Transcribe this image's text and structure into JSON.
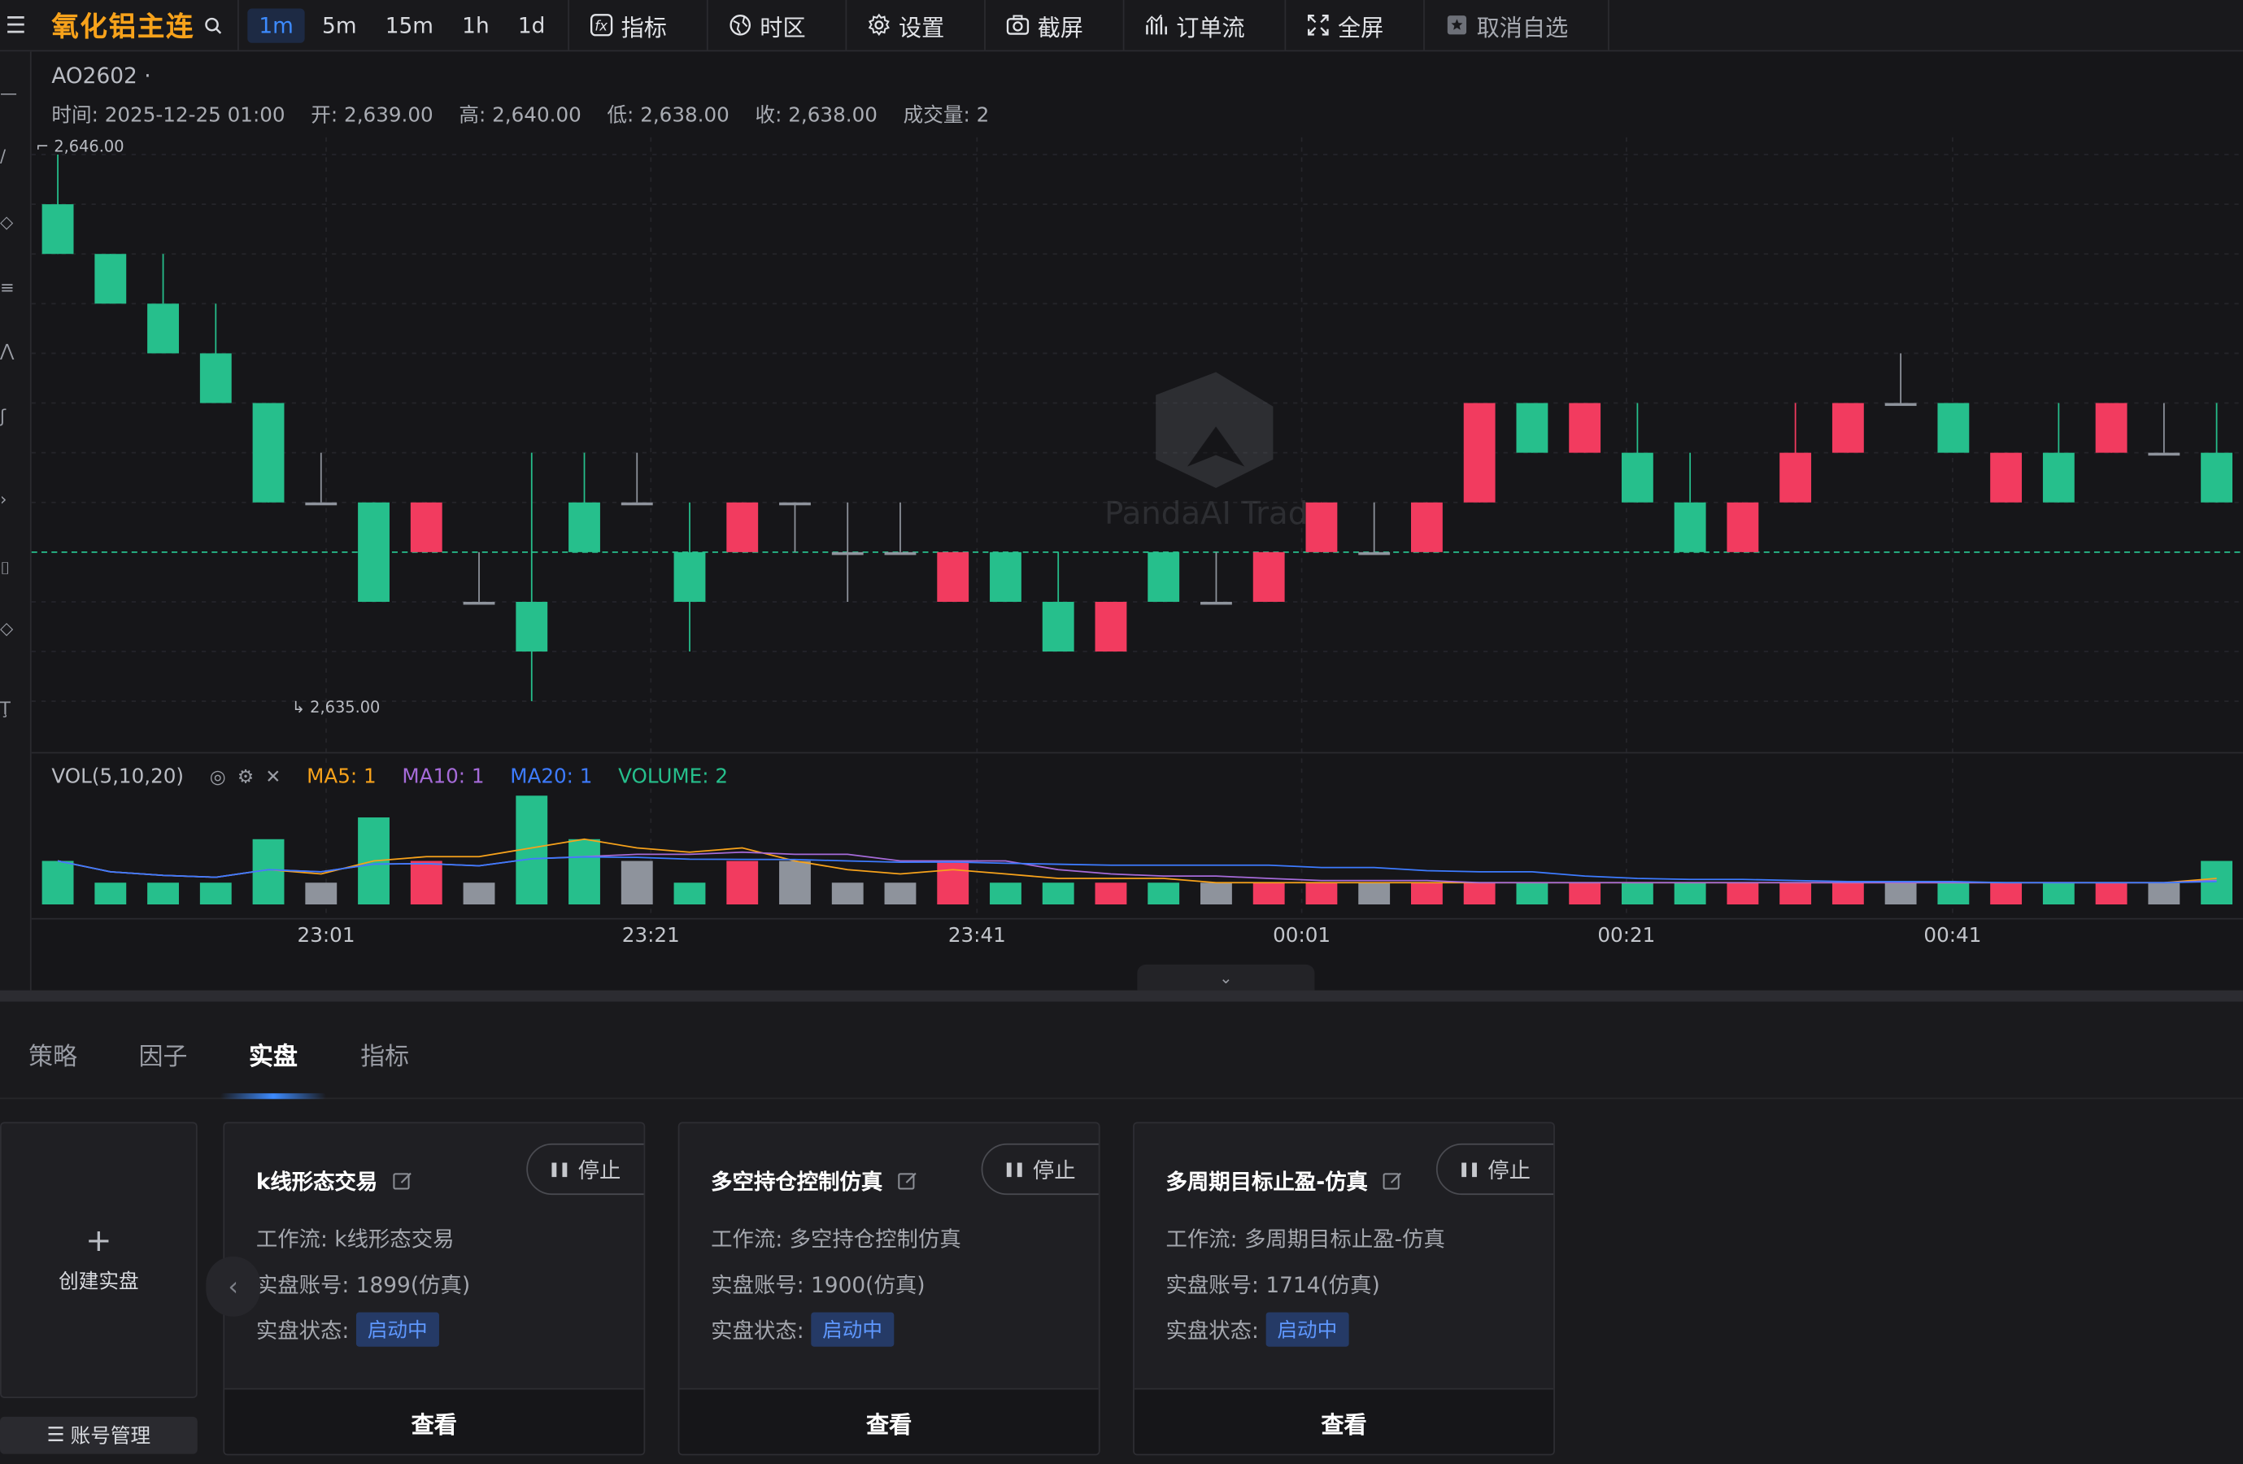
{
  "toolbar": {
    "symbol": "氧化铝主连",
    "periods": [
      "1m",
      "5m",
      "15m",
      "1h",
      "1d"
    ],
    "active_period": "1m",
    "indicators": "指标",
    "timezone": "时区",
    "settings": "设置",
    "screenshot": "截屏",
    "orderflow": "订单流",
    "fullscreen": "全屏",
    "unfavorite": "取消自选"
  },
  "chart": {
    "contract": "AO2602 ·",
    "ohlc": {
      "time_label": "时间:",
      "time": "2025-12-25 01:00",
      "open_label": "开:",
      "open": "2,639.00",
      "high_label": "高:",
      "high": "2,640.00",
      "low_label": "低:",
      "low": "2,638.00",
      "close_label": "收:",
      "close": "2,638.00",
      "volume_label": "成交量:",
      "volume": "2"
    },
    "max_label": "2,646.00",
    "min_label": "2,635.00",
    "watermark": "PandaAI Trade",
    "volume_panel": {
      "title": "VOL(5,10,20)",
      "ma5": "MA5: 1",
      "ma10": "MA10: 1",
      "ma20": "MA20: 1",
      "volume": "VOLUME: 2"
    },
    "time_ticks": [
      "23:01",
      "23:21",
      "23:41",
      "00:01",
      "00:21",
      "00:41"
    ],
    "colors": {
      "up": "#f23b5f",
      "down": "#26bf8c",
      "flat": "#8e939c",
      "ma5": "#f7a21b",
      "ma10": "#a66bd9",
      "ma20": "#3d7bff",
      "volume": "#26bf8c",
      "accent": "#3d8bff"
    }
  },
  "chart_data": {
    "type": "candlestick",
    "y_range": [
      2635,
      2646
    ],
    "reference_price": 2638,
    "candles": [
      [
        2645,
        2646,
        2644,
        2644
      ],
      [
        2644,
        2644,
        2643,
        2643
      ],
      [
        2643,
        2644,
        2643,
        2642
      ],
      [
        2642,
        2643,
        2641,
        2641
      ],
      [
        2641,
        2641,
        2639,
        2639
      ],
      [
        2639,
        2640,
        2639,
        2639
      ],
      [
        2639,
        2639,
        2637,
        2637
      ],
      [
        2638,
        2639,
        2638,
        2639
      ],
      [
        2637,
        2638,
        2637,
        2637
      ],
      [
        2637,
        2640,
        2635,
        2636
      ],
      [
        2639,
        2640,
        2638,
        2638
      ],
      [
        2639,
        2640,
        2639,
        2639
      ],
      [
        2638,
        2639,
        2636,
        2637
      ],
      [
        2638,
        2639,
        2638,
        2639
      ],
      [
        2639,
        2639,
        2638,
        2639
      ],
      [
        2638,
        2639,
        2637,
        2638
      ],
      [
        2638,
        2639,
        2638,
        2638
      ],
      [
        2637,
        2638,
        2637,
        2638
      ],
      [
        2638,
        2638,
        2637,
        2637
      ],
      [
        2637,
        2638,
        2636,
        2636
      ],
      [
        2636,
        2637,
        2636,
        2637
      ],
      [
        2638,
        2638,
        2637,
        2637
      ],
      [
        2637,
        2638,
        2637,
        2637
      ],
      [
        2637,
        2638,
        2637,
        2638
      ],
      [
        2638,
        2639,
        2638,
        2639
      ],
      [
        2638,
        2639,
        2638,
        2638
      ],
      [
        2638,
        2639,
        2638,
        2639
      ],
      [
        2639,
        2641,
        2639,
        2641
      ],
      [
        2641,
        2641,
        2640,
        2640
      ],
      [
        2640,
        2641,
        2640,
        2641
      ],
      [
        2640,
        2641,
        2639,
        2639
      ],
      [
        2639,
        2640,
        2639,
        2638
      ],
      [
        2638,
        2639,
        2638,
        2639
      ],
      [
        2639,
        2641,
        2639,
        2640
      ],
      [
        2640,
        2641,
        2640,
        2641
      ],
      [
        2641,
        2642,
        2641,
        2641
      ],
      [
        2641,
        2641,
        2640,
        2640
      ],
      [
        2639,
        2640,
        2639,
        2640
      ],
      [
        2640,
        2641,
        2639,
        2639
      ],
      [
        2640,
        2641,
        2640,
        2641
      ],
      [
        2640,
        2641,
        2640,
        2640
      ],
      [
        2640,
        2641,
        2639,
        2639
      ]
    ],
    "volume": [
      2,
      1,
      1,
      1,
      3,
      1,
      4,
      2,
      1,
      5,
      3,
      2,
      1,
      2,
      2,
      1,
      1,
      2,
      1,
      1,
      1,
      1,
      1,
      1,
      1,
      1,
      1,
      1,
      1,
      1,
      1,
      1,
      1,
      1,
      1,
      1,
      1,
      1,
      1,
      1,
      1,
      2
    ]
  },
  "panel": {
    "tabs": [
      "策略",
      "因子",
      "实盘",
      "指标"
    ],
    "active_tab": "实盘",
    "create_label": "创建实盘",
    "account_mgmt": "账号管理",
    "cards": [
      {
        "title": "k线形态交易",
        "stop": "停止",
        "workflow_label": "工作流:",
        "workflow": "k线形态交易",
        "account_label": "实盘账号:",
        "account": "1899(仿真)",
        "status_label": "实盘状态:",
        "status": "启动中",
        "view": "查看"
      },
      {
        "title": "多空持仓控制仿真",
        "stop": "停止",
        "workflow_label": "工作流:",
        "workflow": "多空持仓控制仿真",
        "account_label": "实盘账号:",
        "account": "1900(仿真)",
        "status_label": "实盘状态:",
        "status": "启动中",
        "view": "查看"
      },
      {
        "title": "多周期目标止盈-仿真",
        "stop": "停止",
        "workflow_label": "工作流:",
        "workflow": "多周期目标止盈-仿真",
        "account_label": "实盘账号:",
        "account": "1714(仿真)",
        "status_label": "实盘状态:",
        "status": "启动中",
        "view": "查看"
      }
    ]
  }
}
